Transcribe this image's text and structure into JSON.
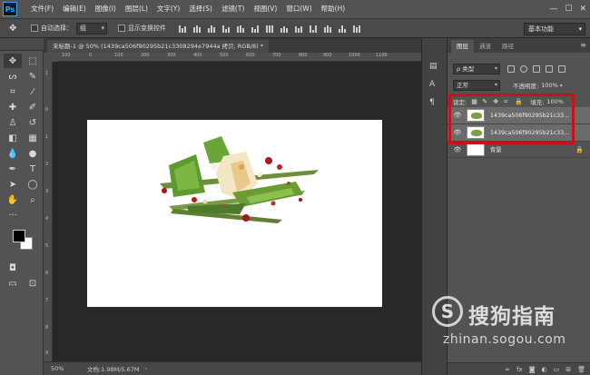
{
  "app": {
    "logo": "Ps"
  },
  "menu": [
    "文件(F)",
    "编辑(E)",
    "图像(I)",
    "图层(L)",
    "文字(Y)",
    "选择(S)",
    "滤镜(T)",
    "视图(V)",
    "窗口(W)",
    "帮助(H)"
  ],
  "window_controls": [
    "—",
    "☐",
    "✕"
  ],
  "options": {
    "auto_select_label": "自动选择：",
    "auto_select_value": "组",
    "transform_controls_label": "显示变换控件",
    "workspace": "基本功能"
  },
  "document": {
    "tab_title": "未标题-1 @ 50% (1439ca506f90295b21c3308294e7944a 拷贝, RGB/8) *",
    "zoom": "50%",
    "doc_size": "文档:1.98M/5.67M",
    "canvas_bg": "#ffffff"
  },
  "ruler_h_ticks": [
    "100",
    "0",
    "100",
    "200",
    "300",
    "400",
    "500",
    "600",
    "700",
    "800",
    "900",
    "1000",
    "1100"
  ],
  "ruler_v_ticks": [
    "1",
    "0",
    "1",
    "2",
    "3",
    "4",
    "5",
    "6",
    "7",
    "8",
    "9"
  ],
  "layers_panel": {
    "tabs": [
      "图层",
      "通道",
      "路径"
    ],
    "filter_kind": "ρ 类型",
    "blend_mode": "正常",
    "opacity_label": "不透明度:",
    "opacity_value": "100%",
    "lock_label": "锁定:",
    "fill_label": "填充:",
    "fill_value": "100%",
    "layers": [
      {
        "name": "1439ca506f90295b21c33...",
        "visible": true,
        "selected": true
      },
      {
        "name": "1439ca506f90295b21c33...",
        "visible": true,
        "selected": true
      },
      {
        "name": "背景",
        "visible": true,
        "selected": false,
        "locked": true
      }
    ],
    "bottom_icons": [
      "link-icon",
      "fx-icon",
      "mask-icon",
      "adjustment-icon",
      "folder-icon",
      "new-layer-icon",
      "trash-icon"
    ]
  },
  "watermark": {
    "logo_letter": "S",
    "title": "搜狗指南",
    "url": "zhinan.sogou.com"
  },
  "colors": {
    "highlight_box": "#c8121a",
    "panel_bg": "#535353",
    "workspace_bg": "#282828"
  }
}
